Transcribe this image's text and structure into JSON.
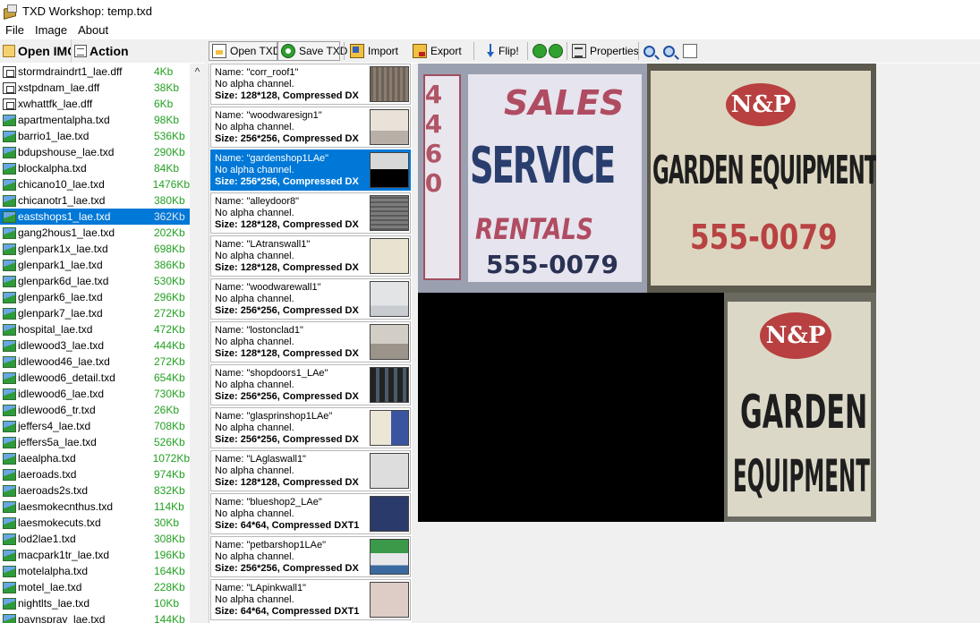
{
  "window": {
    "title": "TXD Workshop: temp.txd"
  },
  "menu": [
    "File",
    "Image",
    "About"
  ],
  "left_toolbar": {
    "open": "Open IMG",
    "action": "Action"
  },
  "toolbar": {
    "open_txd": "Open TXD",
    "save_txd": "Save TXD",
    "import": "Import",
    "export": "Export",
    "flip": "Flip!",
    "properties": "Properties"
  },
  "files": [
    {
      "name": "stormdraindrt1_lae.dff",
      "size": "4Kb",
      "type": "dff"
    },
    {
      "name": "xstpdnam_lae.dff",
      "size": "38Kb",
      "type": "dff"
    },
    {
      "name": "xwhattfk_lae.dff",
      "size": "6Kb",
      "type": "dff"
    },
    {
      "name": "apartmentalpha.txd",
      "size": "98Kb",
      "type": "txd"
    },
    {
      "name": "barrio1_lae.txd",
      "size": "536Kb",
      "type": "txd"
    },
    {
      "name": "bdupshouse_lae.txd",
      "size": "290Kb",
      "type": "txd"
    },
    {
      "name": "blockalpha.txd",
      "size": "84Kb",
      "type": "txd"
    },
    {
      "name": "chicano10_lae.txd",
      "size": "1476Kb",
      "type": "txd"
    },
    {
      "name": "chicanotr1_lae.txd",
      "size": "380Kb",
      "type": "txd"
    },
    {
      "name": "eastshops1_lae.txd",
      "size": "362Kb",
      "type": "txd",
      "selected": true
    },
    {
      "name": "gang2hous1_lae.txd",
      "size": "202Kb",
      "type": "txd"
    },
    {
      "name": "glenpark1x_lae.txd",
      "size": "698Kb",
      "type": "txd"
    },
    {
      "name": "glenpark1_lae.txd",
      "size": "386Kb",
      "type": "txd"
    },
    {
      "name": "glenpark6d_lae.txd",
      "size": "530Kb",
      "type": "txd"
    },
    {
      "name": "glenpark6_lae.txd",
      "size": "296Kb",
      "type": "txd"
    },
    {
      "name": "glenpark7_lae.txd",
      "size": "272Kb",
      "type": "txd"
    },
    {
      "name": "hospital_lae.txd",
      "size": "472Kb",
      "type": "txd"
    },
    {
      "name": "idlewood3_lae.txd",
      "size": "444Kb",
      "type": "txd"
    },
    {
      "name": "idlewood46_lae.txd",
      "size": "272Kb",
      "type": "txd"
    },
    {
      "name": "idlewood6_detail.txd",
      "size": "654Kb",
      "type": "txd"
    },
    {
      "name": "idlewood6_lae.txd",
      "size": "730Kb",
      "type": "txd"
    },
    {
      "name": "idlewood6_tr.txd",
      "size": "26Kb",
      "type": "txd"
    },
    {
      "name": "jeffers4_lae.txd",
      "size": "708Kb",
      "type": "txd"
    },
    {
      "name": "jeffers5a_lae.txd",
      "size": "526Kb",
      "type": "txd"
    },
    {
      "name": "laealpha.txd",
      "size": "1072Kb",
      "type": "txd"
    },
    {
      "name": "laeroads.txd",
      "size": "974Kb",
      "type": "txd"
    },
    {
      "name": "laeroads2s.txd",
      "size": "832Kb",
      "type": "txd"
    },
    {
      "name": "laesmokecnthus.txd",
      "size": "114Kb",
      "type": "txd"
    },
    {
      "name": "laesmokecuts.txd",
      "size": "30Kb",
      "type": "txd"
    },
    {
      "name": "lod2lae1.txd",
      "size": "308Kb",
      "type": "txd"
    },
    {
      "name": "macpark1tr_lae.txd",
      "size": "196Kb",
      "type": "txd"
    },
    {
      "name": "motelalpha.txd",
      "size": "164Kb",
      "type": "txd"
    },
    {
      "name": "motel_lae.txd",
      "size": "228Kb",
      "type": "txd"
    },
    {
      "name": "nightlts_lae.txd",
      "size": "10Kb",
      "type": "txd"
    },
    {
      "name": "paynspray_lae.txd",
      "size": "144Kb",
      "type": "txd"
    }
  ],
  "textures": [
    {
      "name": "Name: \"corr_roof1\"",
      "alpha": "No alpha channel.",
      "size": "Size: 128*128, Compressed DX",
      "thumb": "roof"
    },
    {
      "name": "Name: \"woodwaresign1\"",
      "alpha": "No alpha channel.",
      "size": "Size: 256*256, Compressed DX",
      "thumb": "wood"
    },
    {
      "name": "Name: \"gardenshop1LAe\"",
      "alpha": "No alpha channel.",
      "size": "Size: 256*256, Compressed DX",
      "thumb": "garden",
      "selected": true
    },
    {
      "name": "Name: \"alleydoor8\"",
      "alpha": "No alpha channel.",
      "size": "Size: 128*128, Compressed DX",
      "thumb": "alley"
    },
    {
      "name": "Name: \"LAtranswall1\"",
      "alpha": "No alpha channel.",
      "size": "Size: 128*128, Compressed DX",
      "thumb": "atrans"
    },
    {
      "name": "Name: \"woodwarewall1\"",
      "alpha": "No alpha channel.",
      "size": "Size: 256*256, Compressed DX",
      "thumb": "wwall"
    },
    {
      "name": "Name: \"lostonclad1\"",
      "alpha": "No alpha channel.",
      "size": "Size: 128*128, Compressed DX",
      "thumb": "clad"
    },
    {
      "name": "Name: \"shopdoors1_LAe\"",
      "alpha": "No alpha channel.",
      "size": "Size: 256*256, Compressed DX",
      "thumb": "doors"
    },
    {
      "name": "Name: \"glasprinshop1LAe\"",
      "alpha": "No alpha channel.",
      "size": "Size: 256*256, Compressed DX",
      "thumb": "glas"
    },
    {
      "name": "Name: \"LAglaswall1\"",
      "alpha": "No alpha channel.",
      "size": "Size: 128*128, Compressed DX",
      "thumb": "glwall"
    },
    {
      "name": "Name: \"blueshop2_LAe\"",
      "alpha": "No alpha channel.",
      "size": "Size: 64*64, Compressed DXT1",
      "thumb": "blue"
    },
    {
      "name": "Name: \"petbarshop1LAe\"",
      "alpha": "No alpha channel.",
      "size": "Size: 256*256, Compressed DX",
      "thumb": "pet"
    },
    {
      "name": "Name: \"LApinkwall1\"",
      "alpha": "No alpha channel.",
      "size": "Size: 64*64, Compressed DXT1",
      "thumb": "pink"
    }
  ],
  "preview": {
    "sales_strip": "4460",
    "sales_top": "SALES",
    "sales_mid": "SERVICE",
    "sales_low": "RENTALS",
    "sales_phone": "555-0079",
    "logo": "N&P",
    "ga_line": "GARDEN EQUIPMENT",
    "ga_phone": "555-0079",
    "gb_line1": "GARDEN",
    "gb_line2": "EQUIPMENT"
  },
  "colors": {
    "selection": "#0078d7",
    "file_size": "#22a022",
    "workspace": "#f0f0f0"
  }
}
